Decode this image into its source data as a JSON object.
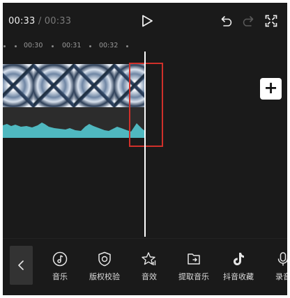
{
  "header": {
    "current_time": "00:33",
    "separator": "/",
    "total_time": "00:33"
  },
  "icons": {
    "play": "play-icon",
    "undo": "undo-icon",
    "redo": "redo-icon",
    "fullscreen": "fullscreen-icon",
    "add": "plus-icon",
    "back": "chevron-left-icon"
  },
  "ruler": {
    "ticks": [
      "00:30",
      "00:31",
      "00:32"
    ]
  },
  "add_clip_label": "+",
  "colors": {
    "background": "#1a1a1a",
    "waveform": "#4fb8c0",
    "highlight": "#d0302a",
    "playhead": "#ffffff"
  },
  "toolbar": {
    "items": [
      {
        "label": "音乐",
        "icon": "music-note-icon"
      },
      {
        "label": "版权校验",
        "icon": "copyright-shield-icon"
      },
      {
        "label": "音效",
        "icon": "sound-effect-star-icon"
      },
      {
        "label": "提取音乐",
        "icon": "extract-folder-icon"
      },
      {
        "label": "抖音收藏",
        "icon": "tiktok-icon"
      },
      {
        "label": "录音",
        "icon": "microphone-icon"
      }
    ]
  }
}
